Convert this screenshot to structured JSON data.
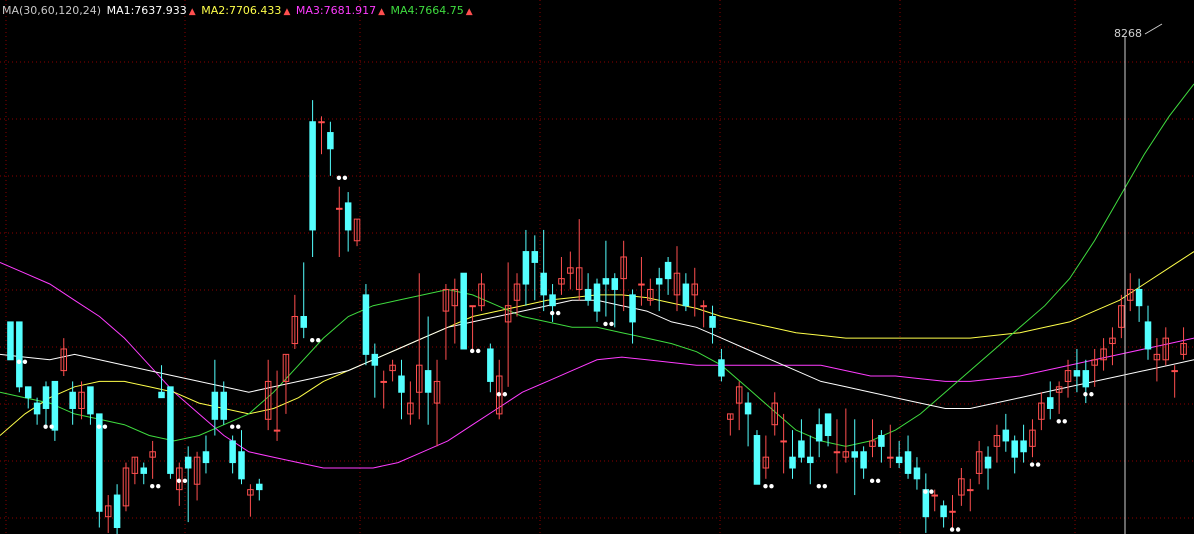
{
  "colors": {
    "up": "#ff4f4f",
    "down": "#54ffff",
    "grid": "#8b0000",
    "dots": "#ffffff"
  },
  "legend": {
    "header": "MA(30,60,120,24)",
    "ma1": {
      "label": "MA1:7637.933",
      "color": "#ffffff"
    },
    "ma2": {
      "label": "MA2:7706.433",
      "color": "#ffff4a"
    },
    "ma3": {
      "label": "MA3:7681.917",
      "color": "#ff3cff"
    },
    "ma4": {
      "label": "MA4:7664.75",
      "color": "#3fdc3f"
    }
  },
  "chart_data": {
    "type": "candlestick",
    "ylim": [
      7378,
      8365
    ],
    "high_label": "8268",
    "candles": [
      [
        7770,
        7770,
        7700,
        7700
      ],
      [
        7770,
        7770,
        7640,
        7650
      ],
      [
        7650,
        7650,
        7610,
        7630
      ],
      [
        7620,
        7630,
        7580,
        7600
      ],
      [
        7650,
        7660,
        7580,
        7610
      ],
      [
        7660,
        7660,
        7550,
        7570
      ],
      [
        7680,
        7740,
        7670,
        7720
      ],
      [
        7640,
        7660,
        7580,
        7610
      ],
      [
        7610,
        7660,
        7590,
        7640
      ],
      [
        7650,
        7650,
        7580,
        7600
      ],
      [
        7600,
        7600,
        7390,
        7420
      ],
      [
        7410,
        7450,
        7380,
        7430
      ],
      [
        7450,
        7470,
        7370,
        7390
      ],
      [
        7430,
        7510,
        7420,
        7500
      ],
      [
        7490,
        7520,
        7470,
        7520
      ],
      [
        7500,
        7510,
        7470,
        7490
      ],
      [
        7520,
        7550,
        7480,
        7530
      ],
      [
        7640,
        7690,
        7630,
        7630
      ],
      [
        7650,
        7650,
        7480,
        7490
      ],
      [
        7460,
        7510,
        7430,
        7500
      ],
      [
        7520,
        7540,
        7400,
        7500
      ],
      [
        7470,
        7530,
        7440,
        7520
      ],
      [
        7530,
        7560,
        7490,
        7510
      ],
      [
        7640,
        7700,
        7560,
        7590
      ],
      [
        7640,
        7660,
        7580,
        7590
      ],
      [
        7550,
        7560,
        7490,
        7510
      ],
      [
        7530,
        7570,
        7470,
        7480
      ],
      [
        7450,
        7470,
        7410,
        7460
      ],
      [
        7470,
        7480,
        7440,
        7460
      ],
      [
        7590,
        7700,
        7570,
        7660
      ],
      [
        7570,
        7680,
        7550,
        7570
      ],
      [
        7660,
        7710,
        7600,
        7710
      ],
      [
        7730,
        7820,
        7720,
        7780
      ],
      [
        7780,
        7880,
        7740,
        7760
      ],
      [
        8140,
        8180,
        7890,
        7940
      ],
      [
        8140,
        8150,
        8080,
        8140
      ],
      [
        8120,
        8140,
        8040,
        8090
      ],
      [
        7980,
        8020,
        7890,
        7980
      ],
      [
        7990,
        8010,
        7900,
        7940
      ],
      [
        7920,
        7960,
        7910,
        7960
      ],
      [
        7820,
        7840,
        7690,
        7710
      ],
      [
        7710,
        7730,
        7630,
        7690
      ],
      [
        7660,
        7680,
        7610,
        7660
      ],
      [
        7680,
        7700,
        7660,
        7690
      ],
      [
        7670,
        7700,
        7590,
        7640
      ],
      [
        7600,
        7660,
        7580,
        7620
      ],
      [
        7640,
        7860,
        7590,
        7690
      ],
      [
        7680,
        7780,
        7580,
        7640
      ],
      [
        7620,
        7700,
        7540,
        7660
      ],
      [
        7790,
        7840,
        7700,
        7830
      ],
      [
        7800,
        7850,
        7730,
        7830
      ],
      [
        7860,
        7860,
        7720,
        7720
      ],
      [
        7800,
        7800,
        7720,
        7800
      ],
      [
        7800,
        7860,
        7790,
        7840
      ],
      [
        7720,
        7730,
        7640,
        7660
      ],
      [
        7600,
        7700,
        7590,
        7670
      ],
      [
        7770,
        7880,
        7650,
        7800
      ],
      [
        7810,
        7860,
        7780,
        7840
      ],
      [
        7900,
        7940,
        7800,
        7840
      ],
      [
        7900,
        7930,
        7810,
        7880
      ],
      [
        7860,
        7940,
        7790,
        7820
      ],
      [
        7820,
        7840,
        7770,
        7800
      ],
      [
        7840,
        7890,
        7820,
        7850
      ],
      [
        7860,
        7900,
        7830,
        7870
      ],
      [
        7830,
        7960,
        7810,
        7870
      ],
      [
        7830,
        7860,
        7800,
        7810
      ],
      [
        7840,
        7850,
        7770,
        7790
      ],
      [
        7850,
        7920,
        7780,
        7840
      ],
      [
        7850,
        7860,
        7760,
        7830
      ],
      [
        7850,
        7920,
        7790,
        7890
      ],
      [
        7820,
        7830,
        7730,
        7770
      ],
      [
        7840,
        7890,
        7800,
        7840
      ],
      [
        7810,
        7850,
        7800,
        7830
      ],
      [
        7850,
        7870,
        7790,
        7840
      ],
      [
        7880,
        7890,
        7820,
        7850
      ],
      [
        7820,
        7910,
        7790,
        7860
      ],
      [
        7840,
        7860,
        7790,
        7800
      ],
      [
        7820,
        7870,
        7780,
        7840
      ],
      [
        7800,
        7810,
        7760,
        7800
      ],
      [
        7780,
        7800,
        7730,
        7760
      ],
      [
        7700,
        7720,
        7660,
        7670
      ],
      [
        7590,
        7600,
        7560,
        7600
      ],
      [
        7620,
        7660,
        7570,
        7650
      ],
      [
        7620,
        7640,
        7540,
        7600
      ],
      [
        7560,
        7570,
        7470,
        7470
      ],
      [
        7500,
        7560,
        7480,
        7520
      ],
      [
        7580,
        7640,
        7560,
        7620
      ],
      [
        7550,
        7600,
        7490,
        7550
      ],
      [
        7520,
        7570,
        7480,
        7500
      ],
      [
        7550,
        7590,
        7510,
        7520
      ],
      [
        7520,
        7560,
        7470,
        7510
      ],
      [
        7580,
        7610,
        7520,
        7550
      ],
      [
        7600,
        7600,
        7540,
        7560
      ],
      [
        7530,
        7590,
        7490,
        7530
      ],
      [
        7520,
        7610,
        7510,
        7530
      ],
      [
        7530,
        7590,
        7450,
        7520
      ],
      [
        7530,
        7540,
        7480,
        7500
      ],
      [
        7540,
        7590,
        7520,
        7550
      ],
      [
        7560,
        7570,
        7510,
        7540
      ],
      [
        7520,
        7580,
        7500,
        7520
      ],
      [
        7520,
        7550,
        7500,
        7510
      ],
      [
        7530,
        7560,
        7480,
        7490
      ],
      [
        7500,
        7520,
        7460,
        7480
      ],
      [
        7460,
        7490,
        7380,
        7410
      ],
      [
        7450,
        7460,
        7420,
        7450
      ],
      [
        7430,
        7440,
        7390,
        7410
      ],
      [
        7420,
        7450,
        7390,
        7420
      ],
      [
        7450,
        7500,
        7430,
        7480
      ],
      [
        7460,
        7480,
        7420,
        7460
      ],
      [
        7490,
        7550,
        7470,
        7530
      ],
      [
        7520,
        7540,
        7460,
        7500
      ],
      [
        7540,
        7580,
        7510,
        7560
      ],
      [
        7570,
        7600,
        7530,
        7550
      ],
      [
        7550,
        7560,
        7490,
        7520
      ],
      [
        7550,
        7580,
        7510,
        7530
      ],
      [
        7540,
        7590,
        7520,
        7570
      ],
      [
        7590,
        7640,
        7570,
        7620
      ],
      [
        7630,
        7660,
        7590,
        7610
      ],
      [
        7640,
        7660,
        7600,
        7650
      ],
      [
        7660,
        7700,
        7630,
        7680
      ],
      [
        7680,
        7720,
        7640,
        7670
      ],
      [
        7680,
        7700,
        7620,
        7650
      ],
      [
        7690,
        7720,
        7650,
        7700
      ],
      [
        7700,
        7740,
        7680,
        7720
      ],
      [
        7730,
        7760,
        7690,
        7740
      ],
      [
        7760,
        7820,
        7740,
        7800
      ],
      [
        7810,
        7860,
        7790,
        7830
      ],
      [
        7830,
        7850,
        7770,
        7800
      ],
      [
        7770,
        7800,
        7700,
        7720
      ],
      [
        7700,
        7740,
        7660,
        7710
      ],
      [
        7700,
        7760,
        7690,
        7740
      ],
      [
        7680,
        7690,
        7630,
        7680
      ],
      [
        7710,
        7760,
        7700,
        7730
      ]
    ],
    "ma1": [
      7710,
      7705,
      7700,
      7710,
      7700,
      7690,
      7680,
      7670,
      7660,
      7650,
      7640,
      7650,
      7660,
      7670,
      7680,
      7700,
      7720,
      7740,
      7760,
      7770,
      7780,
      7790,
      7800,
      7810,
      7810,
      7800,
      7790,
      7770,
      7760,
      7740,
      7720,
      7700,
      7680,
      7660,
      7650,
      7640,
      7630,
      7620,
      7610,
      7610,
      7620,
      7630,
      7640,
      7650,
      7660,
      7670,
      7680,
      7690,
      7700
    ],
    "ma2": [
      7560,
      7600,
      7630,
      7650,
      7660,
      7660,
      7650,
      7640,
      7620,
      7610,
      7600,
      7610,
      7630,
      7660,
      7680,
      7700,
      7720,
      7740,
      7760,
      7780,
      7790,
      7800,
      7810,
      7815,
      7820,
      7820,
      7815,
      7805,
      7795,
      7780,
      7770,
      7760,
      7750,
      7745,
      7740,
      7740,
      7740,
      7740,
      7740,
      7740,
      7745,
      7750,
      7760,
      7770,
      7790,
      7810,
      7840,
      7870,
      7900
    ],
    "ma3": [
      7880,
      7860,
      7840,
      7810,
      7780,
      7740,
      7690,
      7640,
      7600,
      7560,
      7530,
      7520,
      7510,
      7500,
      7500,
      7500,
      7510,
      7530,
      7550,
      7580,
      7610,
      7640,
      7660,
      7680,
      7700,
      7705,
      7700,
      7695,
      7690,
      7690,
      7690,
      7690,
      7690,
      7690,
      7680,
      7670,
      7670,
      7665,
      7660,
      7660,
      7665,
      7670,
      7680,
      7690,
      7700,
      7710,
      7720,
      7730,
      7740
    ],
    "ma4": [
      7640,
      7630,
      7620,
      7600,
      7590,
      7580,
      7560,
      7550,
      7560,
      7580,
      7600,
      7640,
      7690,
      7740,
      7780,
      7800,
      7810,
      7820,
      7830,
      7820,
      7800,
      7780,
      7770,
      7760,
      7760,
      7750,
      7740,
      7730,
      7715,
      7690,
      7650,
      7610,
      7570,
      7550,
      7540,
      7550,
      7570,
      7600,
      7640,
      7680,
      7720,
      7760,
      7800,
      7850,
      7920,
      8000,
      8080,
      8150,
      8210
    ]
  }
}
